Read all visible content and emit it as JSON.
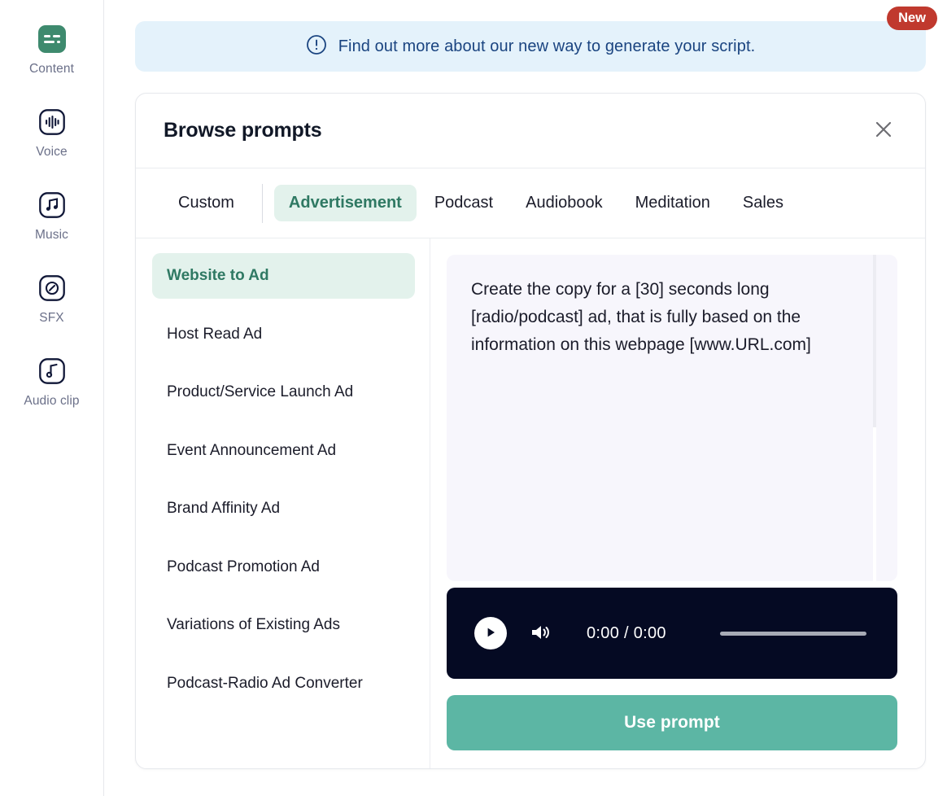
{
  "sidebar": {
    "items": [
      {
        "label": "Content",
        "icon": "content-icon",
        "active": true
      },
      {
        "label": "Voice",
        "icon": "voice-icon",
        "active": false
      },
      {
        "label": "Music",
        "icon": "music-icon",
        "active": false
      },
      {
        "label": "SFX",
        "icon": "sfx-icon",
        "active": false
      },
      {
        "label": "Audio clip",
        "icon": "audio-clip-icon",
        "active": false
      }
    ]
  },
  "banner": {
    "icon": "info-circle-icon",
    "text": "Find out more about our new way to generate your script.",
    "badge": "New",
    "bg_color": "#e4f2fb",
    "text_color": "#1a4480",
    "badge_color": "#c0392e"
  },
  "modal": {
    "title": "Browse prompts",
    "close_icon": "close-icon",
    "tabs": [
      {
        "label": "Custom",
        "active": false
      },
      {
        "label": "Advertisement",
        "active": true
      },
      {
        "label": "Podcast",
        "active": false
      },
      {
        "label": "Audiobook",
        "active": false
      },
      {
        "label": "Meditation",
        "active": false
      },
      {
        "label": "Sales",
        "active": false
      }
    ],
    "prompts": [
      {
        "label": "Website to Ad",
        "active": true
      },
      {
        "label": "Host Read Ad",
        "active": false
      },
      {
        "label": "Product/Service Launch Ad",
        "active": false
      },
      {
        "label": "Event Announcement Ad",
        "active": false
      },
      {
        "label": "Brand Affinity Ad",
        "active": false
      },
      {
        "label": "Podcast Promotion Ad",
        "active": false
      },
      {
        "label": "Variations of Existing Ads",
        "active": false
      },
      {
        "label": "Podcast-Radio Ad Converter",
        "active": false
      }
    ],
    "prompt_text": "Create the copy for a [30] seconds long [radio/podcast] ad, that is fully based on the information on this webpage [www.URL.com]",
    "player": {
      "play_icon": "play-icon",
      "volume_icon": "volume-icon",
      "current_time": "0:00",
      "separator": "/",
      "duration": "0:00",
      "progress_percent": 0
    },
    "use_prompt_label": "Use prompt",
    "accent_color": "#5cb6a4",
    "active_bg": "#e3f2ec",
    "active_text": "#2f7963"
  }
}
